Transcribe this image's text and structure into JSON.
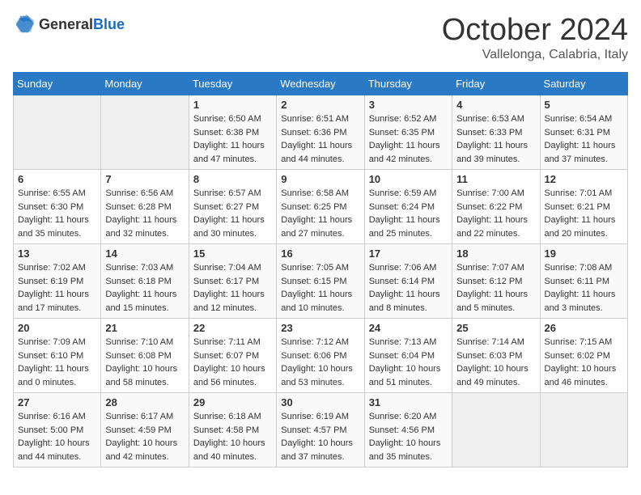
{
  "header": {
    "logo_general": "General",
    "logo_blue": "Blue",
    "month": "October 2024",
    "location": "Vallelonga, Calabria, Italy"
  },
  "weekdays": [
    "Sunday",
    "Monday",
    "Tuesday",
    "Wednesday",
    "Thursday",
    "Friday",
    "Saturday"
  ],
  "weeks": [
    [
      {
        "day": "",
        "sunrise": "",
        "sunset": "",
        "daylight": ""
      },
      {
        "day": "",
        "sunrise": "",
        "sunset": "",
        "daylight": ""
      },
      {
        "day": "1",
        "sunrise": "Sunrise: 6:50 AM",
        "sunset": "Sunset: 6:38 PM",
        "daylight": "Daylight: 11 hours and 47 minutes."
      },
      {
        "day": "2",
        "sunrise": "Sunrise: 6:51 AM",
        "sunset": "Sunset: 6:36 PM",
        "daylight": "Daylight: 11 hours and 44 minutes."
      },
      {
        "day": "3",
        "sunrise": "Sunrise: 6:52 AM",
        "sunset": "Sunset: 6:35 PM",
        "daylight": "Daylight: 11 hours and 42 minutes."
      },
      {
        "day": "4",
        "sunrise": "Sunrise: 6:53 AM",
        "sunset": "Sunset: 6:33 PM",
        "daylight": "Daylight: 11 hours and 39 minutes."
      },
      {
        "day": "5",
        "sunrise": "Sunrise: 6:54 AM",
        "sunset": "Sunset: 6:31 PM",
        "daylight": "Daylight: 11 hours and 37 minutes."
      }
    ],
    [
      {
        "day": "6",
        "sunrise": "Sunrise: 6:55 AM",
        "sunset": "Sunset: 6:30 PM",
        "daylight": "Daylight: 11 hours and 35 minutes."
      },
      {
        "day": "7",
        "sunrise": "Sunrise: 6:56 AM",
        "sunset": "Sunset: 6:28 PM",
        "daylight": "Daylight: 11 hours and 32 minutes."
      },
      {
        "day": "8",
        "sunrise": "Sunrise: 6:57 AM",
        "sunset": "Sunset: 6:27 PM",
        "daylight": "Daylight: 11 hours and 30 minutes."
      },
      {
        "day": "9",
        "sunrise": "Sunrise: 6:58 AM",
        "sunset": "Sunset: 6:25 PM",
        "daylight": "Daylight: 11 hours and 27 minutes."
      },
      {
        "day": "10",
        "sunrise": "Sunrise: 6:59 AM",
        "sunset": "Sunset: 6:24 PM",
        "daylight": "Daylight: 11 hours and 25 minutes."
      },
      {
        "day": "11",
        "sunrise": "Sunrise: 7:00 AM",
        "sunset": "Sunset: 6:22 PM",
        "daylight": "Daylight: 11 hours and 22 minutes."
      },
      {
        "day": "12",
        "sunrise": "Sunrise: 7:01 AM",
        "sunset": "Sunset: 6:21 PM",
        "daylight": "Daylight: 11 hours and 20 minutes."
      }
    ],
    [
      {
        "day": "13",
        "sunrise": "Sunrise: 7:02 AM",
        "sunset": "Sunset: 6:19 PM",
        "daylight": "Daylight: 11 hours and 17 minutes."
      },
      {
        "day": "14",
        "sunrise": "Sunrise: 7:03 AM",
        "sunset": "Sunset: 6:18 PM",
        "daylight": "Daylight: 11 hours and 15 minutes."
      },
      {
        "day": "15",
        "sunrise": "Sunrise: 7:04 AM",
        "sunset": "Sunset: 6:17 PM",
        "daylight": "Daylight: 11 hours and 12 minutes."
      },
      {
        "day": "16",
        "sunrise": "Sunrise: 7:05 AM",
        "sunset": "Sunset: 6:15 PM",
        "daylight": "Daylight: 11 hours and 10 minutes."
      },
      {
        "day": "17",
        "sunrise": "Sunrise: 7:06 AM",
        "sunset": "Sunset: 6:14 PM",
        "daylight": "Daylight: 11 hours and 8 minutes."
      },
      {
        "day": "18",
        "sunrise": "Sunrise: 7:07 AM",
        "sunset": "Sunset: 6:12 PM",
        "daylight": "Daylight: 11 hours and 5 minutes."
      },
      {
        "day": "19",
        "sunrise": "Sunrise: 7:08 AM",
        "sunset": "Sunset: 6:11 PM",
        "daylight": "Daylight: 11 hours and 3 minutes."
      }
    ],
    [
      {
        "day": "20",
        "sunrise": "Sunrise: 7:09 AM",
        "sunset": "Sunset: 6:10 PM",
        "daylight": "Daylight: 11 hours and 0 minutes."
      },
      {
        "day": "21",
        "sunrise": "Sunrise: 7:10 AM",
        "sunset": "Sunset: 6:08 PM",
        "daylight": "Daylight: 10 hours and 58 minutes."
      },
      {
        "day": "22",
        "sunrise": "Sunrise: 7:11 AM",
        "sunset": "Sunset: 6:07 PM",
        "daylight": "Daylight: 10 hours and 56 minutes."
      },
      {
        "day": "23",
        "sunrise": "Sunrise: 7:12 AM",
        "sunset": "Sunset: 6:06 PM",
        "daylight": "Daylight: 10 hours and 53 minutes."
      },
      {
        "day": "24",
        "sunrise": "Sunrise: 7:13 AM",
        "sunset": "Sunset: 6:04 PM",
        "daylight": "Daylight: 10 hours and 51 minutes."
      },
      {
        "day": "25",
        "sunrise": "Sunrise: 7:14 AM",
        "sunset": "Sunset: 6:03 PM",
        "daylight": "Daylight: 10 hours and 49 minutes."
      },
      {
        "day": "26",
        "sunrise": "Sunrise: 7:15 AM",
        "sunset": "Sunset: 6:02 PM",
        "daylight": "Daylight: 10 hours and 46 minutes."
      }
    ],
    [
      {
        "day": "27",
        "sunrise": "Sunrise: 6:16 AM",
        "sunset": "Sunset: 5:00 PM",
        "daylight": "Daylight: 10 hours and 44 minutes."
      },
      {
        "day": "28",
        "sunrise": "Sunrise: 6:17 AM",
        "sunset": "Sunset: 4:59 PM",
        "daylight": "Daylight: 10 hours and 42 minutes."
      },
      {
        "day": "29",
        "sunrise": "Sunrise: 6:18 AM",
        "sunset": "Sunset: 4:58 PM",
        "daylight": "Daylight: 10 hours and 40 minutes."
      },
      {
        "day": "30",
        "sunrise": "Sunrise: 6:19 AM",
        "sunset": "Sunset: 4:57 PM",
        "daylight": "Daylight: 10 hours and 37 minutes."
      },
      {
        "day": "31",
        "sunrise": "Sunrise: 6:20 AM",
        "sunset": "Sunset: 4:56 PM",
        "daylight": "Daylight: 10 hours and 35 minutes."
      },
      {
        "day": "",
        "sunrise": "",
        "sunset": "",
        "daylight": ""
      },
      {
        "day": "",
        "sunrise": "",
        "sunset": "",
        "daylight": ""
      }
    ]
  ]
}
